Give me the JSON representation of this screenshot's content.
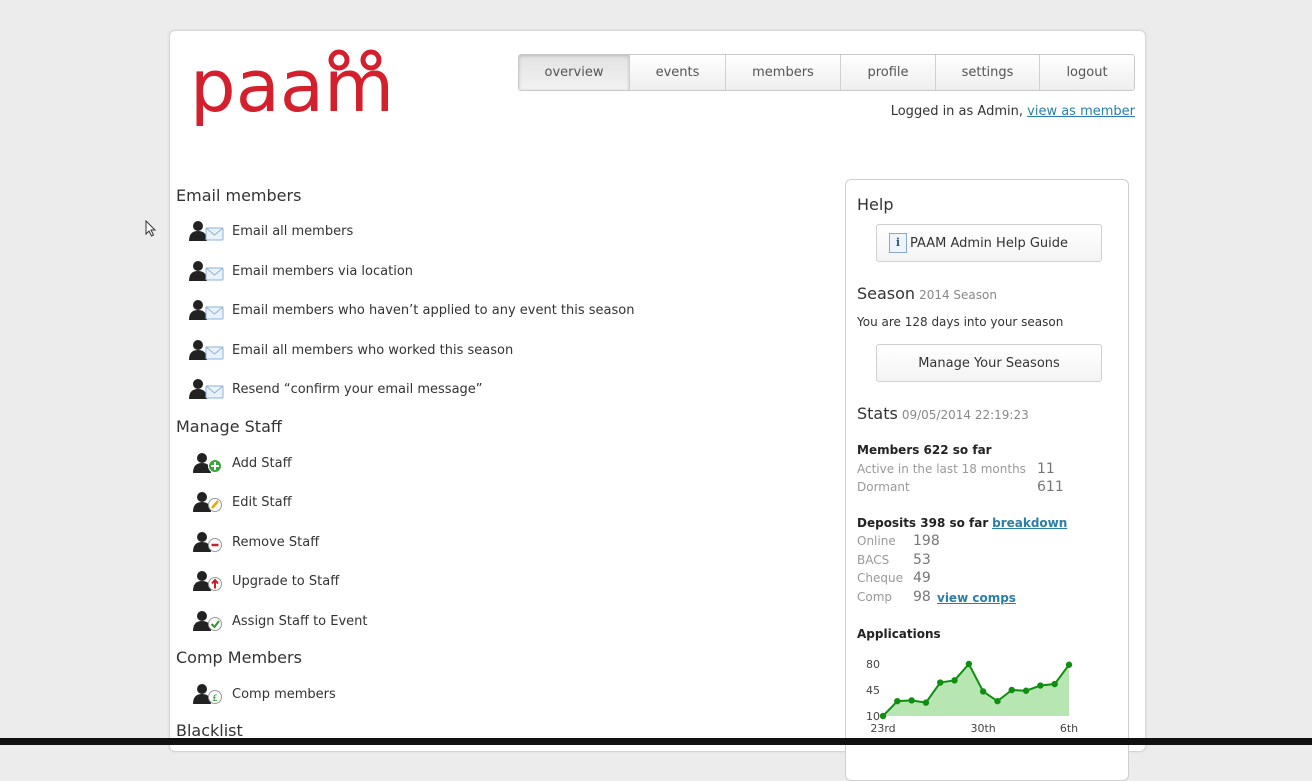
{
  "nav": {
    "tabs": [
      {
        "label": "overview",
        "active": true
      },
      {
        "label": "events"
      },
      {
        "label": "members"
      },
      {
        "label": "profile"
      },
      {
        "label": "settings"
      },
      {
        "label": "logout"
      }
    ]
  },
  "header": {
    "logo_text": "paam",
    "logged_in_text": "Logged in as Admin,",
    "view_as_member": "view as member"
  },
  "sections": {
    "email": {
      "title": "Email members",
      "items": [
        "Email all members",
        "Email members via location",
        "Email members who haven’t applied to any event this season",
        "Email all members who worked this season",
        "Resend “confirm your email message”"
      ]
    },
    "staff": {
      "title": "Manage Staff",
      "items": [
        "Add Staff",
        "Edit Staff",
        "Remove Staff",
        "Upgrade to Staff",
        "Assign Staff to Event"
      ]
    },
    "comp": {
      "title": "Comp Members",
      "items": [
        "Comp members"
      ]
    },
    "blacklist": {
      "title": "Blacklist"
    }
  },
  "sidebar": {
    "help_title": "Help",
    "help_button": "PAAM Admin Help Guide",
    "season_title": "Season",
    "season_sub": "2014 Season",
    "season_text": "You are 128 days into your season",
    "seasons_button": "Manage Your Seasons",
    "stats_title": "Stats",
    "stats_timestamp": "09/05/2014 22:19:23",
    "members_heading": "Members 622 so far",
    "active_label": "Active in the last 18 months",
    "active_value": "11",
    "dormant_label": "Dormant",
    "dormant_value": "611",
    "deposits_heading": "Deposits 398 so far",
    "breakdown_link": "breakdown",
    "online_label": "Online",
    "online_value": "198",
    "bacs_label": "BACS",
    "bacs_value": "53",
    "cheque_label": "Cheque",
    "cheque_value": "49",
    "comp_label": "Comp",
    "comp_value": "98",
    "view_comps_link": "view comps",
    "applications_title": "Applications"
  },
  "colors": {
    "brand": "#d4202c",
    "link": "#2a7fa6",
    "chart_line": "#0f8f0f",
    "chart_fill": "#b8e6b2"
  },
  "chart_data": {
    "type": "area",
    "title": "Applications",
    "x_tick_labels": [
      "23rd",
      "30th",
      "6th"
    ],
    "y_tick_labels": [
      "80",
      "45",
      "10"
    ],
    "ylim": [
      10,
      80
    ],
    "values": [
      10,
      30,
      31,
      28,
      55,
      58,
      80,
      43,
      30,
      45,
      44,
      51,
      53,
      79
    ]
  }
}
